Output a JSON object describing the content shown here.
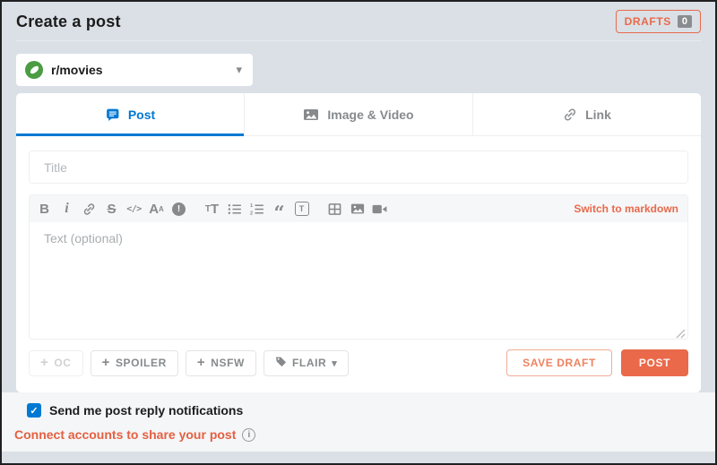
{
  "header": {
    "title": "Create a post",
    "drafts_label": "DRAFTS",
    "drafts_count": "0"
  },
  "community_selector": {
    "selected_community": "r/movies"
  },
  "tabs": {
    "post": "Post",
    "image_video": "Image & Video",
    "link": "Link"
  },
  "form": {
    "title_placeholder": "Title",
    "body_placeholder": "Text (optional)",
    "switch_markdown_label": "Switch to markdown"
  },
  "toolbar": {
    "bold": "B",
    "italic": "i",
    "strikethrough": "S",
    "inline_code": "</>",
    "superscript_base": "A",
    "superscript_mark": "A",
    "spoiler_mark": "!",
    "heading_small": "T",
    "heading_large": "T",
    "quote": "“",
    "code_block": "T"
  },
  "glyphs": {
    "caret_down": "▾",
    "plus": "+",
    "check": "✓",
    "info": "i"
  },
  "actions": {
    "oc": "OC",
    "spoiler": "SPOILER",
    "nsfw": "NSFW",
    "flair": "FLAIR",
    "save_draft": "SAVE DRAFT",
    "post": "POST"
  },
  "footer": {
    "notifications_label": "Send me post reply notifications",
    "connect_label": "Connect accounts to share your post"
  },
  "colors": {
    "accent_orange": "#e9694a",
    "active_tab_blue": "#0079d3",
    "page_bg": "#dae0e6",
    "footer_bg": "#f4f6f7",
    "icon_gray": "#878a8c",
    "community_green": "#4b9c43",
    "post_button_bg": "#e9694a"
  }
}
